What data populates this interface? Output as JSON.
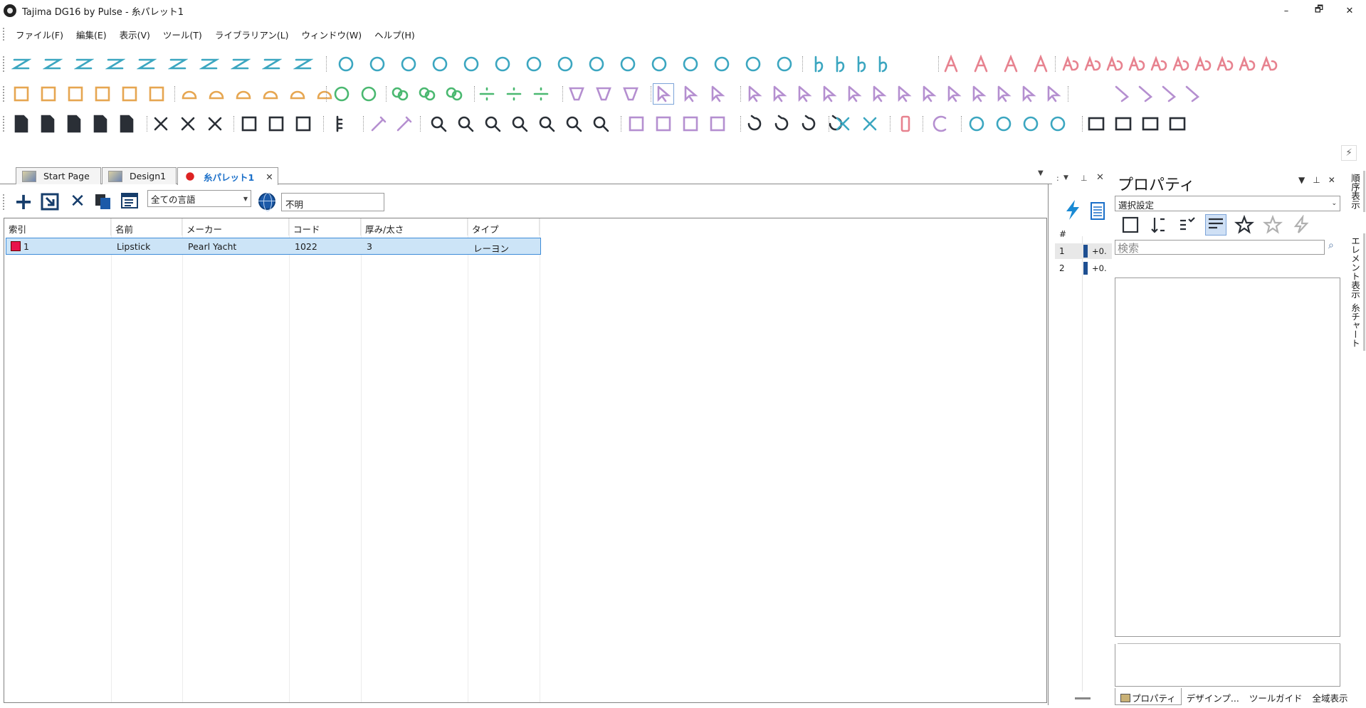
{
  "window": {
    "title": "Tajima DG16 by Pulse - 糸パレット1",
    "controls": {
      "minimize": "–",
      "restore": "🗗",
      "close": "✕"
    }
  },
  "menu": [
    "ファイル(F)",
    "編集(E)",
    "表示(V)",
    "ツール(T)",
    "ライブラリアン(L)",
    "ウィンドウ(W)",
    "ヘルプ(H)"
  ],
  "colors": {
    "accent": "#1a6fc9",
    "teal_tools": "#3ba6c0",
    "purple_tools": "#b58fd0",
    "pink_tools": "#e7828f",
    "orange_tools": "#e6a651",
    "green_tools": "#4ab870",
    "dark_tools": "#2a2f36",
    "swatch": "#e8134c"
  },
  "tabs": [
    {
      "label": "Start Page"
    },
    {
      "label": "Design1"
    },
    {
      "label": "糸パレット1",
      "active": true
    }
  ],
  "palette_toolbar": {
    "add": "+",
    "delete": "✕",
    "language_select": "全ての言語",
    "unknown_field": "不明"
  },
  "grid": {
    "columns": [
      "索引",
      "名前",
      "メーカー",
      "コード",
      "厚み/太さ",
      "タイプ"
    ],
    "rows": [
      {
        "index": "1",
        "name": "Lipstick",
        "maker": "Pearl Yacht",
        "code": "1022",
        "thickness": "3",
        "type": "レーヨン"
      }
    ]
  },
  "sequence_panel": {
    "hash": "#",
    "rows": [
      {
        "num": "1",
        "value": "+0."
      },
      {
        "num": "2",
        "value": "+0."
      }
    ]
  },
  "properties_panel": {
    "title": "プロパティ",
    "select": "選択設定",
    "search_placeholder": "検索",
    "tabs": [
      "プロパティ",
      "デザインプ...",
      "ツールガイド",
      "全域表示"
    ]
  },
  "side_tabs": [
    "順序表示",
    "エレメント表示",
    "糸チャート"
  ]
}
